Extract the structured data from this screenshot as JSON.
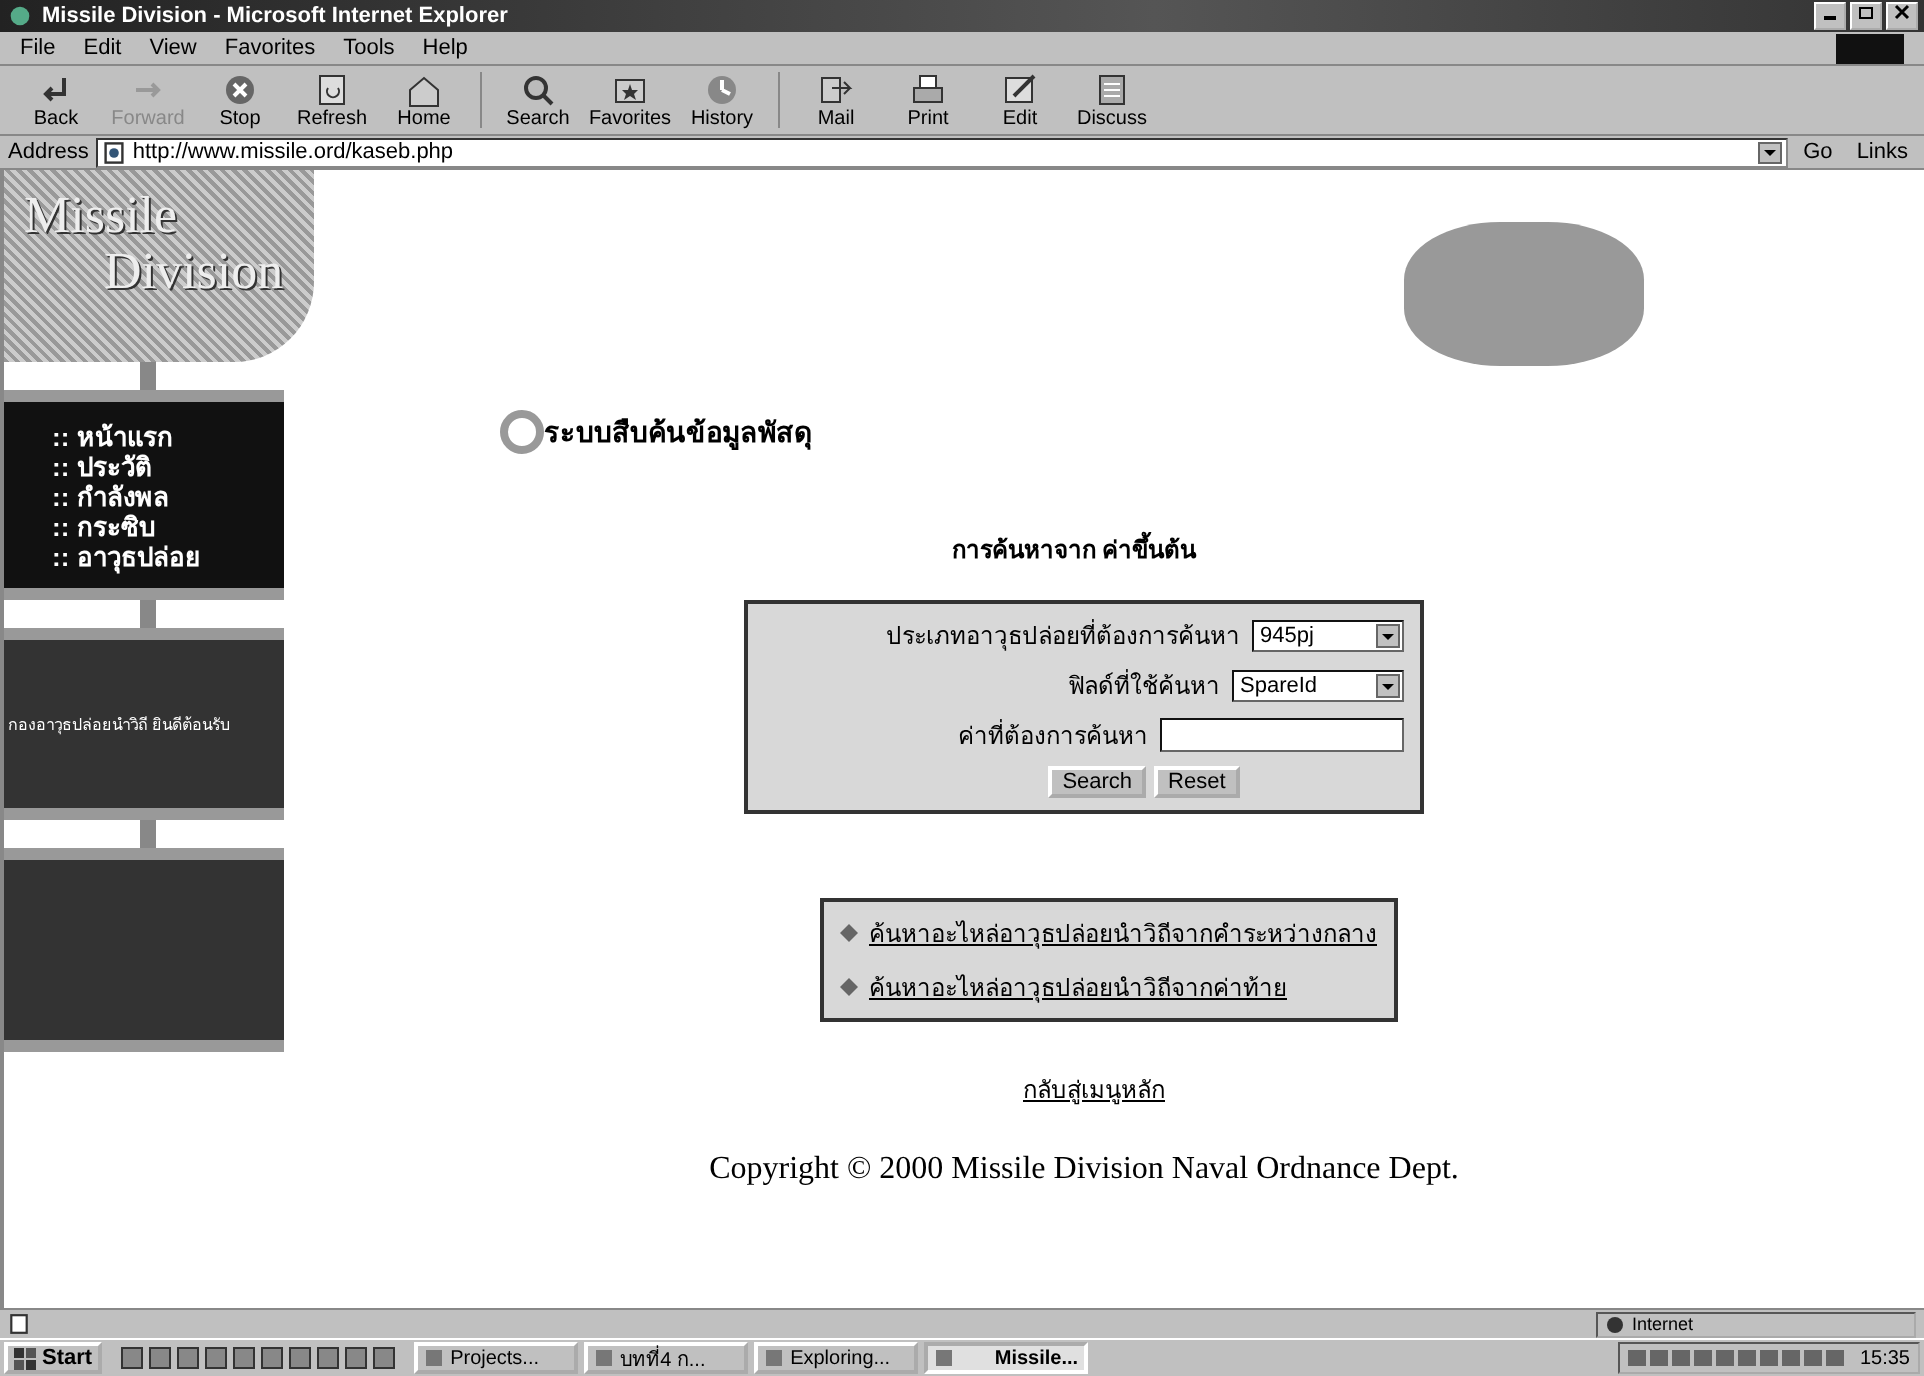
{
  "window": {
    "title": "Missile Division - Microsoft Internet Explorer"
  },
  "menu": [
    "File",
    "Edit",
    "View",
    "Favorites",
    "Tools",
    "Help"
  ],
  "toolbar": [
    {
      "label": "Back",
      "disabled": false
    },
    {
      "label": "Forward",
      "disabled": true
    },
    {
      "label": "Stop",
      "disabled": false
    },
    {
      "label": "Refresh",
      "disabled": false
    },
    {
      "label": "Home",
      "disabled": false
    },
    {
      "label": "Search",
      "disabled": false
    },
    {
      "label": "Favorites",
      "disabled": false
    },
    {
      "label": "History",
      "disabled": false
    },
    {
      "label": "Mail",
      "disabled": false
    },
    {
      "label": "Print",
      "disabled": false
    },
    {
      "label": "Edit",
      "disabled": false
    },
    {
      "label": "Discuss",
      "disabled": false
    }
  ],
  "address": {
    "label": "Address",
    "url": "http://www.missile.ord/kaseb.php",
    "go": "Go",
    "links": "Links"
  },
  "sidebar": {
    "logo": [
      "Missile",
      "Division"
    ],
    "nav": [
      ":: หน้าแรก",
      ":: ประวัติ",
      ":: กำลังพล",
      ":: กระซิบ",
      ":: อาวุธปล่อย"
    ],
    "welcome": "กองอาวุธปล่อยนำวิถี ยินดีต้อนรับ"
  },
  "page": {
    "heading": "ระบบสืบค้นข้อมูลพัสดุ",
    "subtitle": "การค้นหาจาก ค่าขึ้นต้น",
    "fields": [
      {
        "label": "ประเภทอาวุธปล่อยที่ต้องการค้นหา",
        "kind": "select",
        "value": "945pj"
      },
      {
        "label": "ฟิลด์ที่ใช้ค้นหา",
        "kind": "select",
        "value": "SpareId"
      },
      {
        "label": "ค่าที่ต้องการค้นหา",
        "kind": "text"
      }
    ],
    "buttons": [
      "Search",
      "Reset"
    ],
    "links": [
      "ค้นหาอะไหล่อาวุธปล่อยนำวิถีจากคำระหว่างกลาง",
      "ค้นหาอะไหล่อาวุธปล่อยนำวิถีจากค่าท้าย"
    ],
    "back_link": "กลับสู่เมนูหลัก",
    "copyright": "Copyright © 2000 Missile Division Naval Ordnance Dept."
  },
  "status_bar": {
    "zone": "Internet"
  },
  "taskbar": {
    "start": "Start",
    "tasks": [
      {
        "label": "Projects...",
        "selected": false
      },
      {
        "label": "บทที่4 ก...",
        "selected": false
      },
      {
        "label": "Exploring...",
        "selected": false
      },
      {
        "label": "Missile...",
        "selected": true
      }
    ],
    "clock": "15:35"
  }
}
